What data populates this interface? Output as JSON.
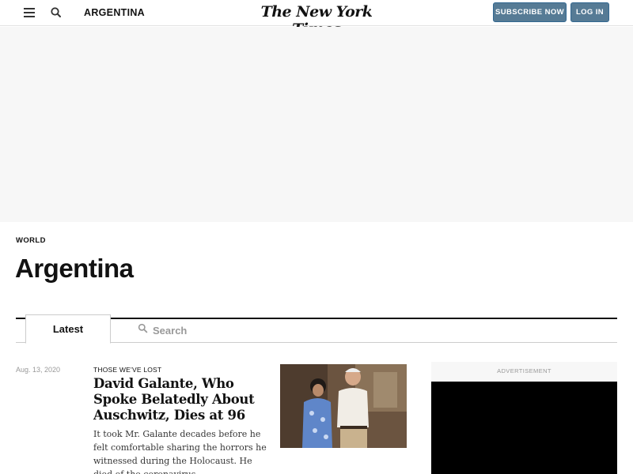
{
  "header": {
    "section": "ARGENTINA",
    "masthead": "The New York Times",
    "subscribe_label": "SUBSCRIBE NOW",
    "login_label": "LOG IN",
    "menu_icon": "hamburger-menu-icon",
    "search_icon": "search-icon"
  },
  "section_header": {
    "kicker": "WORLD",
    "title": "Argentina"
  },
  "tabs": {
    "latest_label": "Latest",
    "search_label": "Search"
  },
  "stories": [
    {
      "date": "Aug. 13, 2020",
      "kicker": "THOSE WE’VE LOST",
      "headline": "David Galante, Who Spoke Belatedly About Auschwitz, Dies at 96",
      "summary": "It took Mr. Galante decades before he felt comfortable sharing the horrors he witnessed during the Holocaust. He died of the coronavirus."
    }
  ],
  "side_ad": {
    "label": "ADVERTISEMENT"
  },
  "colors": {
    "button_blue": "#567b95",
    "ad_background": "#f7f7f7",
    "text": "#121212"
  }
}
